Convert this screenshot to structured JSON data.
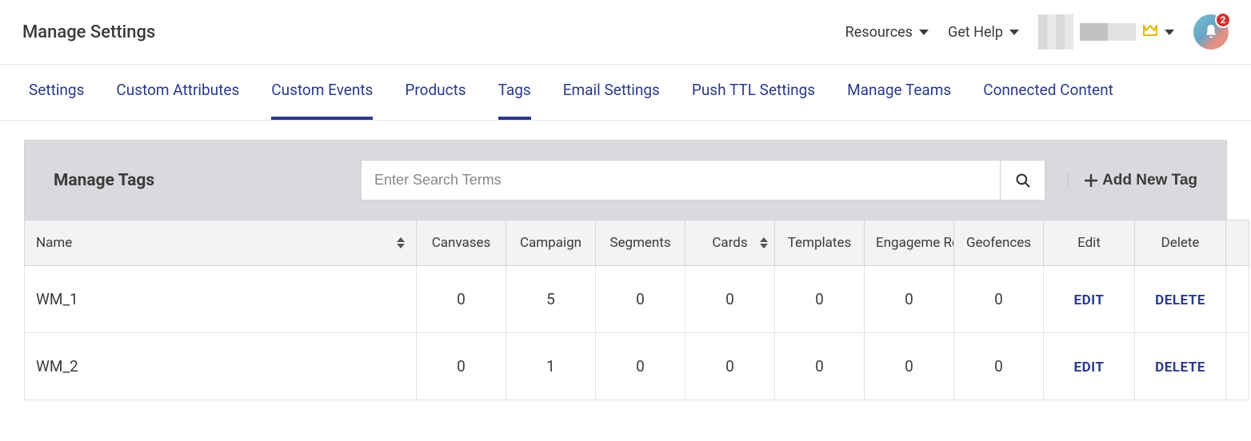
{
  "header": {
    "title": "Manage Settings",
    "resources_label": "Resources",
    "get_help_label": "Get Help",
    "notification_count": "2"
  },
  "tabs": [
    {
      "label": "Settings",
      "active": false
    },
    {
      "label": "Custom Attributes",
      "active": false
    },
    {
      "label": "Custom Events",
      "active": true
    },
    {
      "label": "Products",
      "active": false
    },
    {
      "label": "Tags",
      "active": true
    },
    {
      "label": "Email Settings",
      "active": false
    },
    {
      "label": "Push TTL Settings",
      "active": false
    },
    {
      "label": "Manage Teams",
      "active": false
    },
    {
      "label": "Connected Content",
      "active": false
    }
  ],
  "panel": {
    "title": "Manage Tags",
    "search_placeholder": "Enter Search Terms",
    "add_tag_label": "Add New Tag"
  },
  "columns": {
    "name": "Name",
    "canvases": "Canvases",
    "campaigns": "Campaign",
    "segments": "Segments",
    "cards": "Cards",
    "templates": "Templates",
    "engagement_reports": "Engageme Reports",
    "geofences": "Geofences",
    "edit": "Edit",
    "delete": "Delete"
  },
  "actions": {
    "edit": "EDIT",
    "delete": "DELETE"
  },
  "rows": [
    {
      "name": "WM_1",
      "canvases": "0",
      "campaigns": "5",
      "segments": "0",
      "cards": "0",
      "templates": "0",
      "engagement_reports": "0",
      "geofences": "0"
    },
    {
      "name": "WM_2",
      "canvases": "0",
      "campaigns": "1",
      "segments": "0",
      "cards": "0",
      "templates": "0",
      "engagement_reports": "0",
      "geofences": "0"
    }
  ]
}
